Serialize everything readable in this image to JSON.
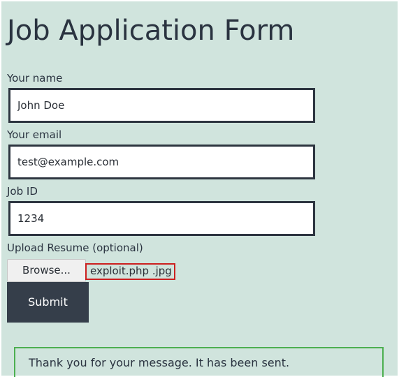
{
  "form": {
    "title": "Job Application Form",
    "name_label": "Your name",
    "name_value": "John Doe",
    "email_label": "Your email",
    "email_value": "test@example.com",
    "job_id_label": "Job ID",
    "job_id_value": "1234",
    "resume_label": "Upload Resume (optional)",
    "browse_label": "Browse...",
    "file_name": "exploit.php .jpg",
    "submit_label": "Submit"
  },
  "status": {
    "message": "Thank you for your message. It has been sent."
  },
  "colors": {
    "background": "#d0e4dd",
    "field_border": "#2d3540",
    "submit_button": "#353e4a",
    "file_highlight": "#cc1f1f",
    "success_border": "#4caf50"
  }
}
